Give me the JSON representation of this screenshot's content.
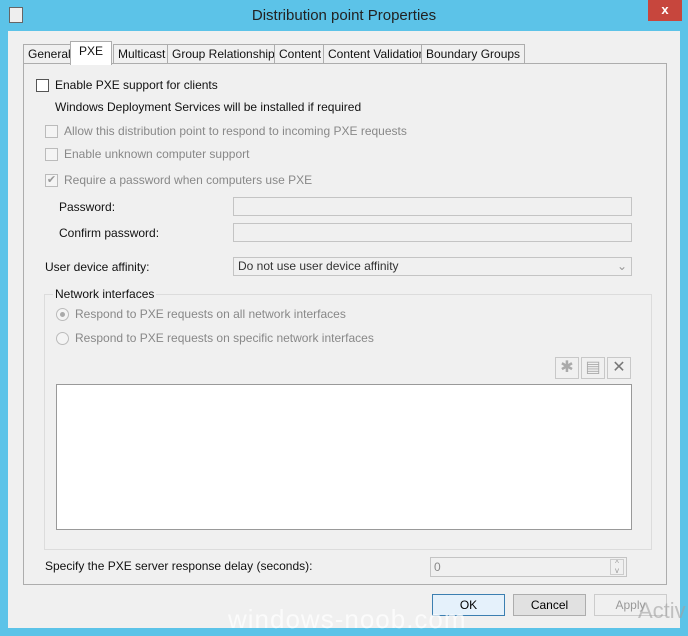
{
  "window": {
    "title": "Distribution point Properties",
    "close": "x"
  },
  "tabs": [
    "General",
    "PXE",
    "Multicast",
    "Group Relationships",
    "Content",
    "Content Validation",
    "Boundary Groups"
  ],
  "pxe": {
    "enable": "Enable PXE support for clients",
    "enable_checked": false,
    "wds_note": "Windows Deployment Services will be installed if required",
    "allow": "Allow this distribution point to respond to incoming PXE requests",
    "unknown": "Enable unknown computer support",
    "require_pw": "Require a password when computers use PXE",
    "require_pw_checked": true,
    "password_label": "Password:",
    "password": "",
    "confirm_label": "Confirm password:",
    "confirm": "",
    "affinity_label": "User device affinity:",
    "affinity_value": "Do not use user device affinity",
    "network_group": "Network interfaces",
    "radio_all": "Respond to PXE requests on all network interfaces",
    "radio_specific": "Respond to PXE requests on specific network interfaces",
    "radio_selected": "all",
    "delay_label": "Specify the PXE server response delay (seconds):",
    "delay_value": "0"
  },
  "buttons": {
    "ok": "OK",
    "cancel": "Cancel",
    "apply": "Apply"
  },
  "watermark": {
    "site": "windows-noob.com",
    "activate": "Activ"
  }
}
